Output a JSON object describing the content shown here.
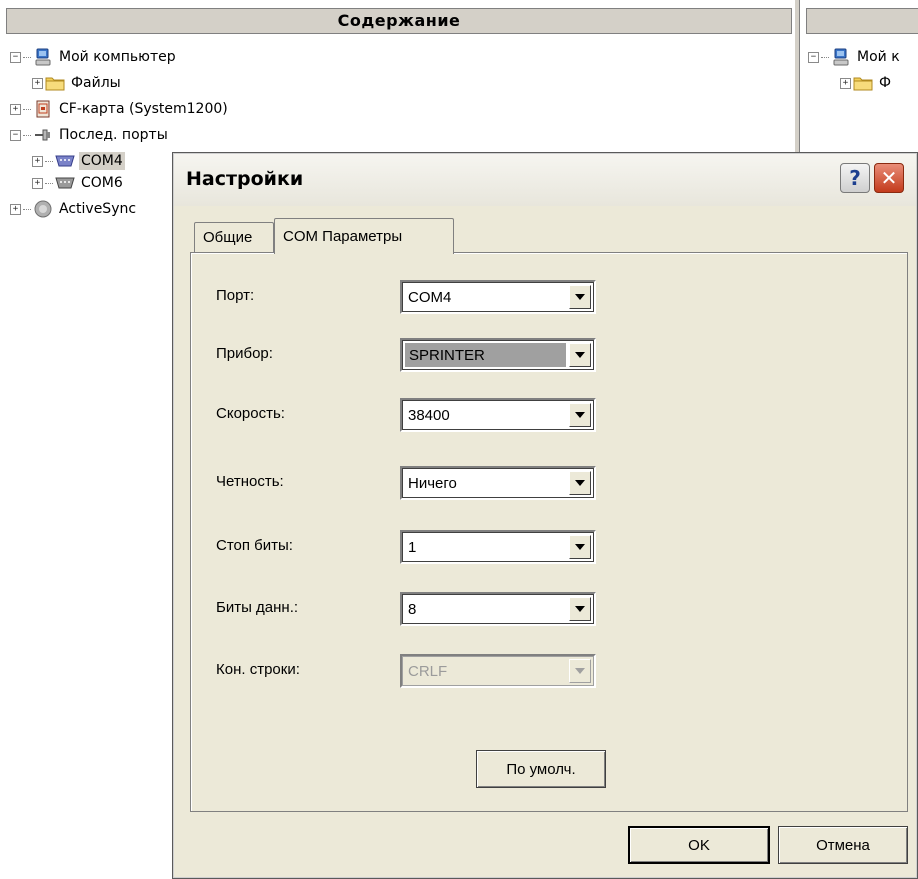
{
  "left_panel": {
    "title": "Содержание",
    "tree": [
      {
        "label": "Мой компьютер",
        "expander": "−",
        "icon": "computer-icon"
      },
      {
        "label": "Файлы",
        "expander": "+",
        "icon": "folder-icon"
      },
      {
        "label": "CF-карта (System1200)",
        "expander": "+",
        "icon": "cf-card-icon"
      },
      {
        "label": "Послед. порты",
        "expander": "−",
        "icon": "serial-port-icon"
      },
      {
        "label": "COM4",
        "expander": "+",
        "icon": "com-port-icon",
        "selected": true
      },
      {
        "label": "COM6",
        "expander": "+",
        "icon": "com-port-icon"
      },
      {
        "label": "ActiveSync",
        "expander": "+",
        "icon": "activesync-icon"
      }
    ]
  },
  "right_panel": {
    "tree": [
      {
        "label": "Мой к",
        "expander": "−",
        "icon": "computer-icon"
      },
      {
        "label": "Ф",
        "expander": "+",
        "icon": "folder-icon"
      }
    ]
  },
  "dialog": {
    "title": "Настройки",
    "help_label": "?",
    "close_label": "✕",
    "tabs": [
      {
        "label": "Общие",
        "active": false
      },
      {
        "label": "COM Параметры",
        "active": true
      }
    ],
    "fields": [
      {
        "label": "Порт:",
        "value": "COM4"
      },
      {
        "label": "Прибор:",
        "value": "SPRINTER"
      },
      {
        "label": "Скорость:",
        "value": "38400"
      },
      {
        "label": "Четность:",
        "value": "Ничего"
      },
      {
        "label": "Стоп биты:",
        "value": "1"
      },
      {
        "label": "Биты данн.:",
        "value": "8"
      },
      {
        "label": "Кон. строки:",
        "value": "CRLF"
      }
    ],
    "defaults_label": "По умолч.",
    "ok_label": "OK",
    "cancel_label": "Отмена"
  },
  "colors": {
    "dialog_bg": "#ece9d8",
    "close_button": "#c33b1c",
    "selection": "#d4d0c8"
  }
}
